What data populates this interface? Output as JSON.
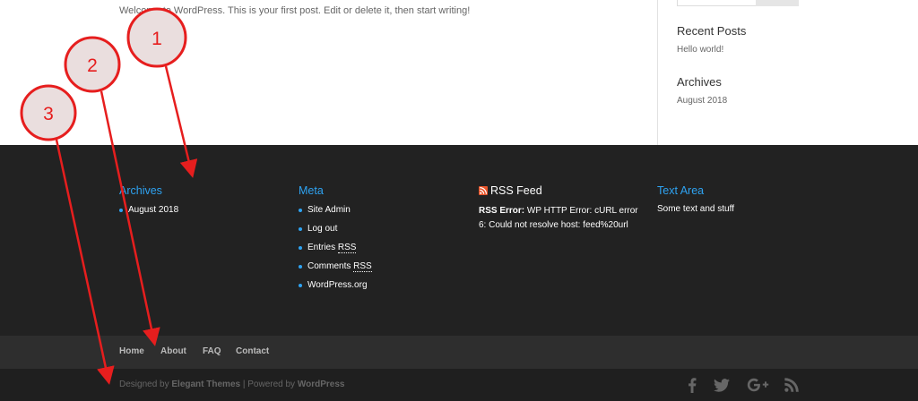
{
  "post": {
    "text": "Welcome to WordPress. This is your first post. Edit or delete it, then start writing!"
  },
  "sidebar": {
    "recent_posts_title": "Recent Posts",
    "recent_post_1": "Hello world!",
    "archives_title": "Archives",
    "archive_1": "August 2018"
  },
  "footer_widgets": {
    "archives": {
      "title": "Archives",
      "items": [
        "August 2018"
      ]
    },
    "meta": {
      "title": "Meta",
      "site_admin": "Site Admin",
      "log_out": "Log out",
      "entries_prefix": "Entries",
      "comments_prefix": "Comments",
      "rss_abbr": "RSS",
      "wordpress_org": "WordPress.org"
    },
    "rss": {
      "title": "RSS Feed",
      "error_label": "RSS Error:",
      "error_text": "WP HTTP Error: cURL error 6: Could not resolve host: feed%20url"
    },
    "text_area": {
      "title": "Text Area",
      "text": "Some text and stuff"
    }
  },
  "footer_nav": {
    "items": [
      "Home",
      "About",
      "FAQ",
      "Contact"
    ]
  },
  "footer_bottom": {
    "designed_by": "Designed by",
    "elegant_themes": "Elegant Themes",
    "separator": "|",
    "powered_by": "Powered by",
    "wordpress": "WordPress",
    "social_icons": [
      "facebook-icon",
      "twitter-icon",
      "google-plus-icon",
      "rss-icon"
    ]
  },
  "annotations": {
    "labels": [
      "1",
      "2",
      "3"
    ],
    "color": "#e61e1e"
  },
  "colors": {
    "accent": "#2ea3f2",
    "footer_bg": "#222222",
    "footer_nav_bg": "#2e2e2e",
    "footer_bottom_bg": "#1f1f1f"
  }
}
